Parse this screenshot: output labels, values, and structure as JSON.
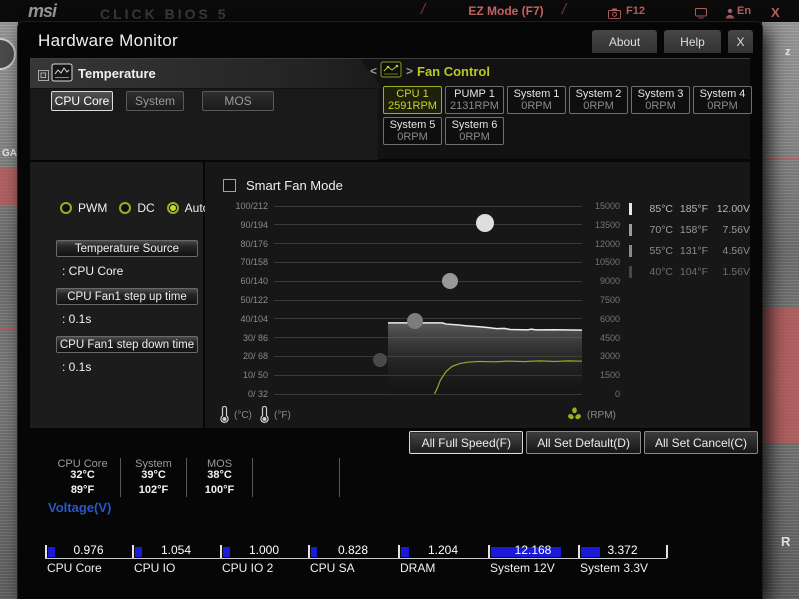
{
  "background": {
    "brand": "msi",
    "brand_suffix": "CLICK BIOS 5",
    "ez_mode_label": "EZ Mode (F7)",
    "screenshot_key": "F12",
    "language_label": "En",
    "close_label": "X",
    "left_edge_text": "GA",
    "right_edge_top_text": "z",
    "right_edge_bottom_text": "R"
  },
  "dialog": {
    "title": "Hardware Monitor",
    "tabs": [
      {
        "label": "About"
      },
      {
        "label": "Help"
      },
      {
        "label": "X"
      }
    ]
  },
  "temperature": {
    "title": "Temperature",
    "tabs": [
      {
        "label": "CPU Core",
        "active": true
      },
      {
        "label": "System"
      },
      {
        "label": "MOS"
      }
    ]
  },
  "fan_control": {
    "title": "Fan Control",
    "fans": [
      {
        "name": "CPU 1",
        "rpm": "2591RPM",
        "active": true
      },
      {
        "name": "PUMP 1",
        "rpm": "2131RPM"
      },
      {
        "name": "System 1",
        "rpm": "0RPM"
      },
      {
        "name": "System 2",
        "rpm": "0RPM"
      },
      {
        "name": "System 3",
        "rpm": "0RPM"
      },
      {
        "name": "System 4",
        "rpm": "0RPM"
      },
      {
        "name": "System 5",
        "rpm": "0RPM"
      },
      {
        "name": "System 6",
        "rpm": "0RPM"
      }
    ]
  },
  "fan_settings": {
    "modes": [
      {
        "label": "PWM"
      },
      {
        "label": "DC"
      },
      {
        "label": "Auto",
        "selected": true
      }
    ],
    "fields": [
      {
        "label": "Temperature Source",
        "value": ": CPU Core"
      },
      {
        "label": "CPU Fan1 step up time",
        "value": ": 0.1s"
      },
      {
        "label": "CPU Fan1 step down time",
        "value": ": 0.1s"
      }
    ]
  },
  "chart": {
    "type": "line",
    "checkbox_label": "Smart Fan Mode",
    "checkbox_checked": false,
    "temp_axis_ticks": [
      "100/212",
      "90/194",
      "80/176",
      "70/158",
      "60/140",
      "50/122",
      "40/104",
      "30/ 86",
      "20/ 68",
      "10/ 50",
      "0/ 32"
    ],
    "rpm_axis_ticks": [
      "15000",
      "13500",
      "12000",
      "10500",
      "9000",
      "7500",
      "6000",
      "4500",
      "3000",
      "1500",
      "0"
    ],
    "temp_axis_range": [
      0,
      100
    ],
    "rpm_axis_range": [
      0,
      15000
    ],
    "unit_celsius": "(°C)",
    "unit_fahrenheit": "(°F)",
    "unit_rpm": "(RPM)",
    "fan_curve_points": [
      {
        "x_frac": 0.344,
        "percent": 18
      },
      {
        "x_frac": 0.458,
        "percent": 39
      },
      {
        "x_frac": 0.571,
        "percent": 60
      },
      {
        "x_frac": 0.685,
        "percent": 91
      }
    ],
    "history_window": [
      0.37,
      1.0
    ],
    "temp_history": [
      [
        0,
        37.8
      ],
      [
        0.28,
        37.8
      ],
      [
        0.3,
        37.2
      ],
      [
        0.36,
        36.8
      ],
      [
        0.4,
        36.3
      ],
      [
        0.47,
        35.8
      ],
      [
        0.52,
        35.3
      ],
      [
        0.56,
        34.8
      ],
      [
        0.6,
        34.9
      ],
      [
        0.63,
        34.3
      ],
      [
        0.72,
        34.1
      ],
      [
        0.74,
        34.5
      ],
      [
        0.76,
        34.1
      ],
      [
        0.86,
        34.2
      ],
      [
        1,
        34.0
      ]
    ],
    "rpm_history": [
      [
        0.24,
        0
      ],
      [
        0.255,
        500
      ],
      [
        0.27,
        1100
      ],
      [
        0.3,
        1800
      ],
      [
        0.33,
        2200
      ],
      [
        0.37,
        2430
      ],
      [
        0.41,
        2540
      ],
      [
        0.47,
        2600
      ],
      [
        0.55,
        2570
      ],
      [
        0.62,
        2620
      ],
      [
        0.7,
        2590
      ],
      [
        0.78,
        2640
      ],
      [
        0.86,
        2600
      ],
      [
        0.93,
        2640
      ],
      [
        1,
        2620
      ]
    ]
  },
  "fan_curve_table": {
    "rows": [
      {
        "celsius": "85°C",
        "fahrenheit": "185°F",
        "voltage": "12.00V"
      },
      {
        "celsius": "70°C",
        "fahrenheit": "158°F",
        "voltage": "7.56V"
      },
      {
        "celsius": "55°C",
        "fahrenheit": "131°F",
        "voltage": "4.56V"
      },
      {
        "celsius": "40°C",
        "fahrenheit": "104°F",
        "voltage": "1.56V"
      }
    ]
  },
  "actions": [
    {
      "label": "All Full Speed(F)",
      "primary": true
    },
    {
      "label": "All Set Default(D)"
    },
    {
      "label": "All Set Cancel(C)"
    }
  ],
  "temperature_summary": [
    {
      "name": "CPU Core",
      "celsius": "32°C",
      "fahrenheit": "89°F"
    },
    {
      "name": "System",
      "celsius": "39°C",
      "fahrenheit": "102°F"
    },
    {
      "name": "MOS",
      "celsius": "38°C",
      "fahrenheit": "100°F"
    }
  ],
  "voltage": {
    "title": "Voltage(V)",
    "rails": [
      {
        "name": "CPU Core",
        "value": "0.976",
        "fill_percent": 9
      },
      {
        "name": "CPU IO",
        "value": "1.054",
        "fill_percent": 9
      },
      {
        "name": "CPU IO 2",
        "value": "1.000",
        "fill_percent": 9
      },
      {
        "name": "CPU SA",
        "value": "0.828",
        "fill_percent": 7
      },
      {
        "name": "DRAM",
        "value": "1.204",
        "fill_percent": 9
      },
      {
        "name": "System 12V",
        "value": "12.168",
        "fill_percent": 83
      },
      {
        "name": "System 3.3V",
        "value": "3.372",
        "fill_percent": 23
      }
    ]
  },
  "colors": {
    "accent_green": "#b9c829",
    "voltage_bar_blue": "#1a1ad8",
    "voltage_title_blue": "#2a57c8",
    "background_red": "#cf6565",
    "history_rpm_line": "#98ab22",
    "history_temp_line": "#ececec"
  }
}
